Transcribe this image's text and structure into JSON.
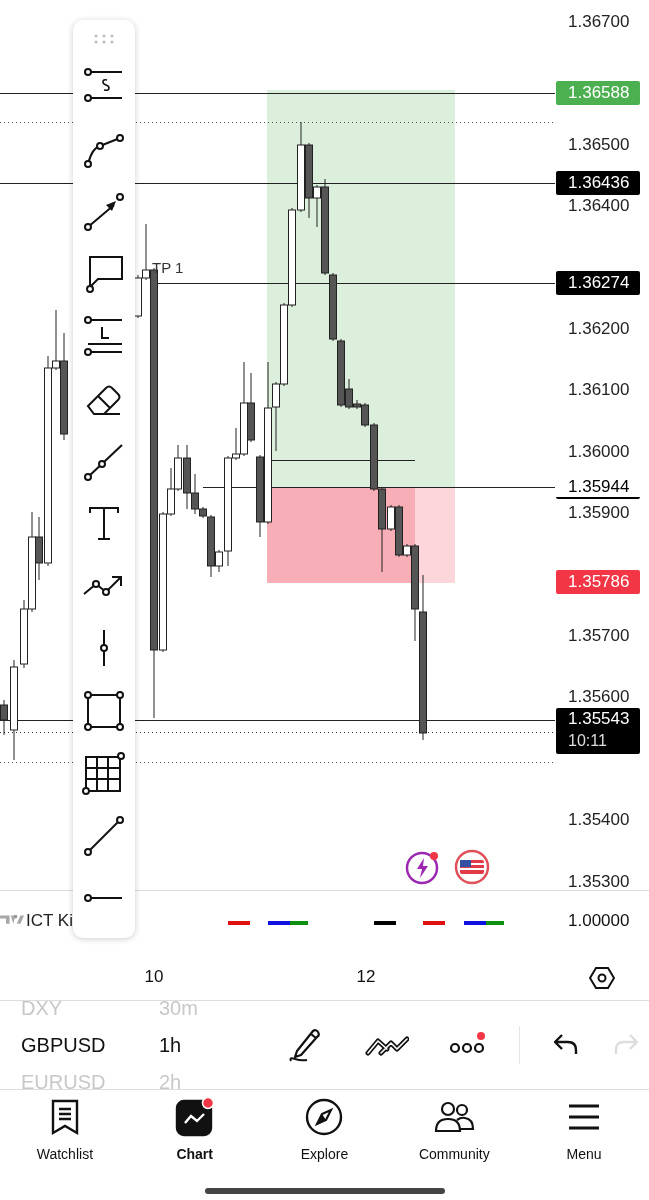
{
  "chart": {
    "tp_label": "TP 1",
    "price_labels": [
      "1.36700",
      "1.36500",
      "1.36400",
      "1.36200",
      "1.36100",
      "1.36000",
      "1.35900",
      "1.35700",
      "1.35600",
      "1.35400",
      "1.35300"
    ],
    "price_tags": [
      {
        "price": "1.36588",
        "kind": "fill",
        "color": "#4caf50"
      },
      {
        "price": "1.36436",
        "kind": "fill",
        "color": "#000000"
      },
      {
        "price": "1.36274",
        "kind": "fill",
        "color": "#000000"
      },
      {
        "price": "1.35944",
        "kind": "outline",
        "color": "#000000"
      },
      {
        "price": "1.35786",
        "kind": "fill",
        "color": "#f23645"
      },
      {
        "price": "1.35543",
        "kind": "fill",
        "color": "#000000",
        "countdown": "10:11"
      }
    ],
    "indicator": {
      "name": "ICT Ki",
      "value": "1.00000",
      "swatch_groups": [
        {
          "segments": [
            {
              "color": "#e01010"
            }
          ]
        },
        {
          "segments": [
            {
              "color": "#1010e0"
            },
            {
              "color": "#109010"
            }
          ]
        },
        {
          "segments": [
            {
              "color": "#000000"
            }
          ]
        },
        {
          "segments": [
            {
              "color": "#e01010"
            }
          ]
        },
        {
          "segments": [
            {
              "color": "#1010e0"
            },
            {
              "color": "#109010"
            }
          ]
        }
      ]
    }
  },
  "time_labels": [
    "10",
    "12"
  ],
  "symbols": [
    {
      "symbol": "DXY",
      "interval": "30m",
      "selected": false
    },
    {
      "symbol": "GBPUSD",
      "interval": "1h",
      "selected": true
    },
    {
      "symbol": "EURUSD",
      "interval": "2h",
      "selected": false
    }
  ],
  "drawing_bar": {
    "more_badge": true,
    "redo_disabled": true
  },
  "nav": [
    {
      "label": "Watchlist",
      "selected": false,
      "badge": false
    },
    {
      "label": "Chart",
      "selected": true,
      "badge": true
    },
    {
      "label": "Explore",
      "selected": false,
      "badge": false
    },
    {
      "label": "Community",
      "selected": false,
      "badge": false
    },
    {
      "label": "Menu",
      "selected": false,
      "badge": false
    }
  ]
}
